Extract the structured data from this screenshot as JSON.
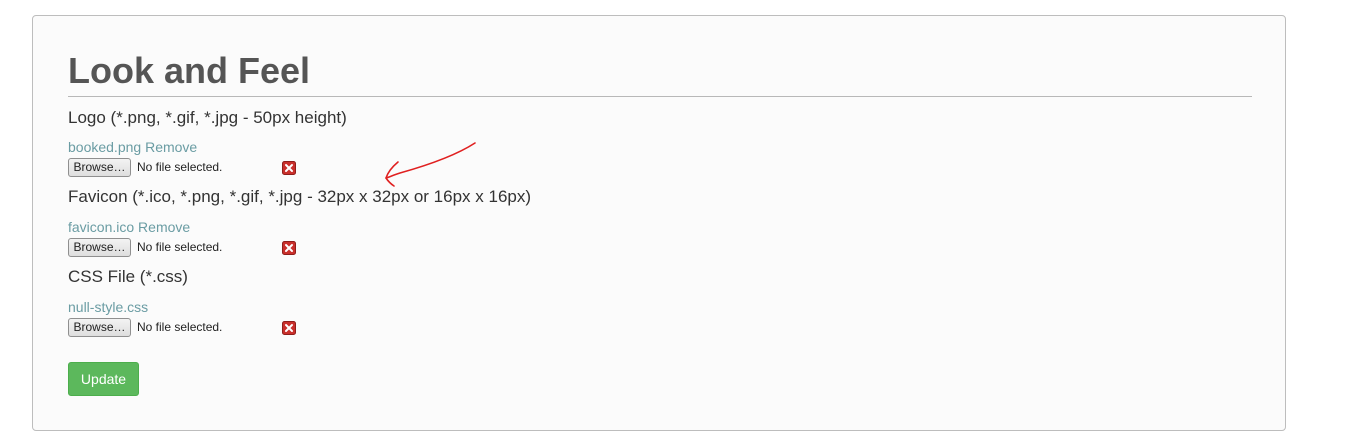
{
  "page": {
    "title": "Look and Feel"
  },
  "logo": {
    "label": "Logo (*.png, *.gif, *.jpg - 50px height)",
    "current_file": "booked.png",
    "remove_label": "Remove",
    "browse_label": "Browse…",
    "status": "No file selected."
  },
  "favicon": {
    "label": "Favicon (*.ico, *.png, *.gif, *.jpg - 32px x 32px or 16px x 16px)",
    "current_file": "favicon.ico",
    "remove_label": "Remove",
    "browse_label": "Browse…",
    "status": "No file selected."
  },
  "css": {
    "label": "CSS File (*.css)",
    "current_file": "null-style.css",
    "browse_label": "Browse…",
    "status": "No file selected."
  },
  "actions": {
    "update_label": "Update"
  },
  "icons": {
    "clear": "clear-icon",
    "annotation": "red-arrow-annotation"
  },
  "colors": {
    "link": "#6a9ca3",
    "update_button": "#5cb85c",
    "clear_icon": "#c9302c",
    "annotation": "#e02020"
  }
}
